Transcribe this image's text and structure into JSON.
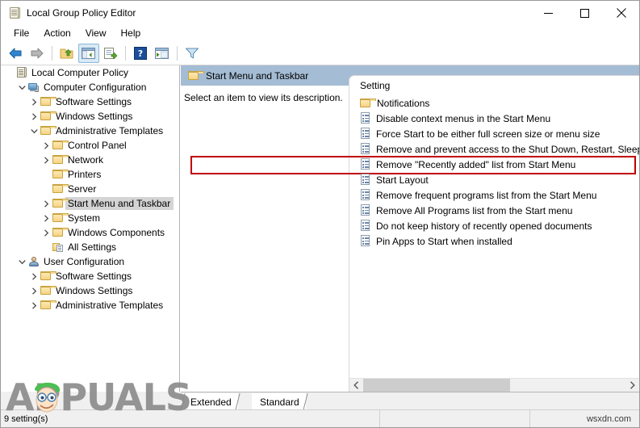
{
  "window": {
    "title": "Local Group Policy Editor",
    "icon": "group-policy-scroll-icon",
    "controls": {
      "minimize": "minimize-icon",
      "maximize": "maximize-icon",
      "close": "close-icon"
    }
  },
  "menubar": {
    "items": [
      {
        "label": "File"
      },
      {
        "label": "Action"
      },
      {
        "label": "View"
      },
      {
        "label": "Help"
      }
    ]
  },
  "toolbar": {
    "buttons": [
      {
        "name": "back-button",
        "icon": "back-arrow-icon"
      },
      {
        "name": "forward-button",
        "icon": "forward-arrow-icon"
      },
      {
        "name": "up-one-level-button",
        "icon": "folder-up-icon"
      },
      {
        "name": "show-hide-tree-button",
        "icon": "console-tree-icon",
        "active": true
      },
      {
        "name": "export-list-button",
        "icon": "export-list-icon"
      },
      {
        "name": "help-button",
        "icon": "help-question-icon"
      },
      {
        "name": "properties-button",
        "icon": "properties-window-icon"
      },
      {
        "name": "filter-button",
        "icon": "filter-funnel-icon"
      }
    ]
  },
  "tree": {
    "items": [
      {
        "label": "Local Computer Policy",
        "indent": 0,
        "icon": "policy-scroll-icon",
        "chevron": "none",
        "selected": false
      },
      {
        "label": "Computer Configuration",
        "indent": 1,
        "icon": "computer-icon",
        "chevron": "down",
        "selected": false
      },
      {
        "label": "Software Settings",
        "indent": 2,
        "icon": "folder-icon",
        "chevron": "right",
        "selected": false
      },
      {
        "label": "Windows Settings",
        "indent": 2,
        "icon": "folder-icon",
        "chevron": "right",
        "selected": false
      },
      {
        "label": "Administrative Templates",
        "indent": 2,
        "icon": "folder-icon",
        "chevron": "down",
        "selected": false
      },
      {
        "label": "Control Panel",
        "indent": 3,
        "icon": "folder-icon",
        "chevron": "right",
        "selected": false
      },
      {
        "label": "Network",
        "indent": 3,
        "icon": "folder-icon",
        "chevron": "right",
        "selected": false
      },
      {
        "label": "Printers",
        "indent": 3,
        "icon": "folder-icon",
        "chevron": "none",
        "selected": false
      },
      {
        "label": "Server",
        "indent": 3,
        "icon": "folder-icon",
        "chevron": "none",
        "selected": false
      },
      {
        "label": "Start Menu and Taskbar",
        "indent": 3,
        "icon": "folder-icon",
        "chevron": "right",
        "selected": true
      },
      {
        "label": "System",
        "indent": 3,
        "icon": "folder-icon",
        "chevron": "right",
        "selected": false
      },
      {
        "label": "Windows Components",
        "indent": 3,
        "icon": "folder-icon",
        "chevron": "right",
        "selected": false
      },
      {
        "label": "All Settings",
        "indent": 3,
        "icon": "all-settings-icon",
        "chevron": "none",
        "selected": false
      },
      {
        "label": "User Configuration",
        "indent": 1,
        "icon": "user-icon",
        "chevron": "down",
        "selected": false
      },
      {
        "label": "Software Settings",
        "indent": 2,
        "icon": "folder-icon",
        "chevron": "right",
        "selected": false
      },
      {
        "label": "Windows Settings",
        "indent": 2,
        "icon": "folder-icon",
        "chevron": "right",
        "selected": false
      },
      {
        "label": "Administrative Templates",
        "indent": 2,
        "icon": "folder-icon",
        "chevron": "right",
        "selected": false
      }
    ]
  },
  "right_pane": {
    "header_title": "Start Menu and Taskbar",
    "header_icon": "folder-icon",
    "description": "Select an item to view its description.",
    "column_header": "Setting",
    "settings": [
      {
        "label": "Notifications",
        "icon": "folder-icon",
        "highlighted": false
      },
      {
        "label": "Disable context menus in the Start Menu",
        "icon": "policy-icon",
        "highlighted": false
      },
      {
        "label": "Force Start to be either full screen size or menu size",
        "icon": "policy-icon",
        "highlighted": false
      },
      {
        "label": "Remove and prevent access to the Shut Down, Restart, Sleep...",
        "icon": "policy-icon",
        "highlighted": false
      },
      {
        "label": "Remove \"Recently added\" list from Start Menu",
        "icon": "policy-icon",
        "highlighted": true
      },
      {
        "label": "Start Layout",
        "icon": "policy-icon",
        "highlighted": false
      },
      {
        "label": "Remove frequent programs list from the Start Menu",
        "icon": "policy-icon",
        "highlighted": false
      },
      {
        "label": "Remove All Programs list from the Start menu",
        "icon": "policy-icon",
        "highlighted": false
      },
      {
        "label": "Do not keep history of recently opened documents",
        "icon": "policy-icon",
        "highlighted": false
      },
      {
        "label": "Pin Apps to Start when installed",
        "icon": "policy-icon",
        "highlighted": false
      }
    ],
    "scrollbar": {
      "left_arrow": "chevron-left-icon",
      "right_arrow": "chevron-right-icon"
    }
  },
  "tabs": [
    {
      "label": "Extended",
      "active": false
    },
    {
      "label": "Standard",
      "active": true
    }
  ],
  "statusbar": {
    "count_text": "9 setting(s)",
    "watermark_right": "wsxdn.com"
  },
  "watermark": {
    "text": "APPUALS"
  },
  "colors": {
    "header_blue": "#a4bcd4",
    "highlight_red": "#c00000",
    "tree_selection": "#d4d4d4",
    "toolbar_active": "#d8eaf7"
  }
}
